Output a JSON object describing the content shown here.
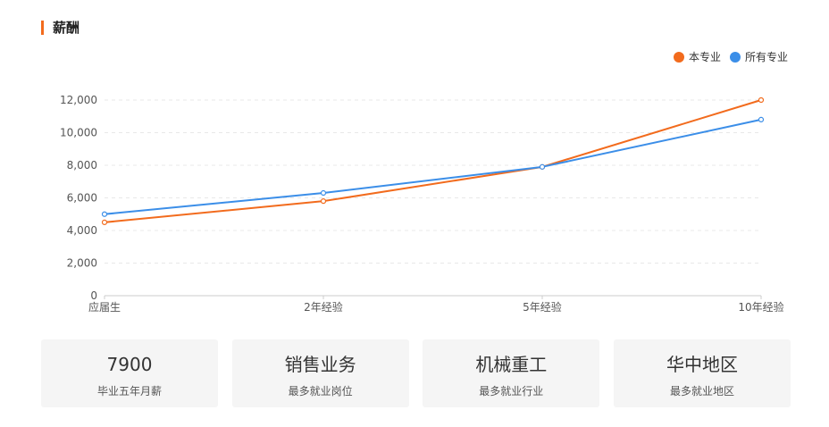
{
  "section": {
    "title": "薪酬"
  },
  "colors": {
    "accent": "#f26b1d",
    "series_major": "#f26b1d",
    "series_all": "#3b8ee8"
  },
  "chart_data": {
    "type": "line",
    "title": "",
    "xlabel": "",
    "ylabel": "",
    "categories": [
      "应届生",
      "2年经验",
      "5年经验",
      "10年经验"
    ],
    "y_ticks": [
      "0",
      "2,000",
      "4,000",
      "6,000",
      "8,000",
      "10,000",
      "12,000"
    ],
    "ylim": [
      0,
      12000
    ],
    "grid": true,
    "legend_position": "top-right",
    "series": [
      {
        "name": "本专业",
        "color": "#f26b1d",
        "values": [
          4500,
          5800,
          7900,
          12000
        ]
      },
      {
        "name": "所有专业",
        "color": "#3b8ee8",
        "values": [
          5000,
          6300,
          7900,
          10800
        ]
      }
    ]
  },
  "cards": [
    {
      "value": "7900",
      "label": "毕业五年月薪"
    },
    {
      "value": "销售业务",
      "label": "最多就业岗位"
    },
    {
      "value": "机械重工",
      "label": "最多就业行业"
    },
    {
      "value": "华中地区",
      "label": "最多就业地区"
    }
  ]
}
